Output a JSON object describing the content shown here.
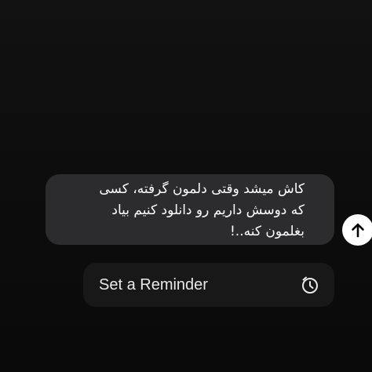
{
  "message": {
    "text": "کاش میشد وقتی دلمون گرفته، کسی\nکه دوسش داریم رو دانلود کنیم بیاد\nبغلمون کنه..!"
  },
  "send_button": {
    "icon": "arrow-up-icon"
  },
  "reminder": {
    "label": "Set a Reminder",
    "icon": "alarm-clock-icon"
  },
  "colors": {
    "background": "#0d0d0d",
    "bubble": "#2c2c2e",
    "reminder_background": "#181818",
    "send_button": "#ffffff"
  }
}
